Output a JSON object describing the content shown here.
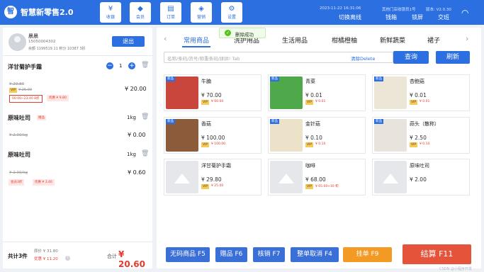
{
  "app": {
    "title": "智慧新零售2.0",
    "logo_icon": "store-logo-icon"
  },
  "nav": [
    {
      "label": "收银",
      "icon": "cashier-icon",
      "glyph": "¥"
    },
    {
      "label": "会员",
      "icon": "member-diamond-icon",
      "glyph": "◆"
    },
    {
      "label": "订单",
      "icon": "order-list-icon",
      "glyph": "▤"
    },
    {
      "label": "营销",
      "icon": "tag-icon",
      "glyph": "◈"
    },
    {
      "label": "设置",
      "icon": "settings-icon",
      "glyph": "⚙"
    }
  ],
  "status": {
    "datetime": "2023-11-22 16:31:06",
    "store": "其他门店收银员1号",
    "version": "版本: V2.0.30",
    "actions": [
      "切换离线",
      "钱箱",
      "锁屏",
      "交班"
    ]
  },
  "member": {
    "name": "晨晨",
    "phone": "15050004302",
    "balance_points": "余额 1199519.11   积分 10387   3折",
    "logout": "退出"
  },
  "cart": {
    "items": [
      {
        "name": "洋甘菊护手霜",
        "qty": "1",
        "orig": "¥ 29.80",
        "member_price": "¥ 25.00",
        "time_range": "00:00~23:40 8折",
        "discount": "优惠 ¥ 9.80",
        "price": "¥ 20.00"
      },
      {
        "name": "原味吐司",
        "gift": "赠品",
        "unit": "1kg",
        "orig": "¥ 2.00/kg",
        "price": "¥ 0.00"
      },
      {
        "name": "原味吐司",
        "unit": "1kg",
        "orig": "¥ 2.00/kg",
        "member_tag": "会员3折",
        "discount": "优惠 ¥ 3.40",
        "price": "¥ 0.60"
      }
    ],
    "summary": {
      "count": "共计3件",
      "orig": "原价 ¥ 31.80",
      "discount": "优惠 ¥ 11.20",
      "total_label": "合计",
      "total": "¥ 20.60"
    }
  },
  "toast": {
    "text": "删除成功",
    "icon": "check-circle-icon"
  },
  "tabs": [
    "常用商品",
    "洗护用品",
    "生活用品",
    "柑橘橙柚",
    "新鲜蔬菜",
    "裙子"
  ],
  "search": {
    "placeholder": "名称/条码/货号/称重条码/拼拼! Tab",
    "clear": "清除Delete",
    "query": "查询",
    "refresh": "刷新"
  },
  "products": [
    {
      "name": "牛腩",
      "price": "¥ 70.00",
      "vip": "¥ 60.00",
      "badge": "新品",
      "thumb": "#c9463c"
    },
    {
      "name": "青菜",
      "price": "¥ 0.01",
      "vip": "¥ 0.01",
      "badge": "新品",
      "thumb": "#4fa94a"
    },
    {
      "name": "杏鲍菇",
      "price": "¥ 0.01",
      "vip": "¥ 0.01",
      "badge": "新品",
      "thumb": "#ece6d6"
    },
    {
      "name": "香菇",
      "price": "¥ 100.00",
      "vip": "¥ 100.00",
      "badge": "新品",
      "thumb": "#8c5b3a"
    },
    {
      "name": "金针菇",
      "price": "¥ 0.10",
      "vip": "¥ 0.10",
      "badge": "新品",
      "thumb": "#ebe2c9"
    },
    {
      "name": "蒜头（散称）",
      "price": "¥ 2.50",
      "vip": "¥ 0.10",
      "badge": "新品",
      "thumb": "#e8e3dc"
    },
    {
      "name": "洋甘菊护手霜",
      "price": "¥ 29.80",
      "vip": "¥ 25.00",
      "badge": "",
      "thumb": ""
    },
    {
      "name": "咖啡",
      "price": "¥ 68.00",
      "vip": "¥ 65.00+10 积",
      "badge": "",
      "thumb": ""
    },
    {
      "name": "原味吐司",
      "price": "¥ 2.00",
      "vip": "",
      "badge": "",
      "thumb": ""
    }
  ],
  "functions": [
    {
      "label": "无码商品 F5",
      "color": "#3b6fd8"
    },
    {
      "label": "赠品 F6",
      "color": "#3b6fd8"
    },
    {
      "label": "核销 F7",
      "color": "#3b6fd8"
    },
    {
      "label": "整单取消 F4",
      "color": "#3b6fd8"
    },
    {
      "label": "挂单 F9",
      "color": "#f39a25"
    },
    {
      "label": "结算 F11",
      "color": "#e5533a"
    }
  ],
  "watermark": "CSDN @小程序开发"
}
